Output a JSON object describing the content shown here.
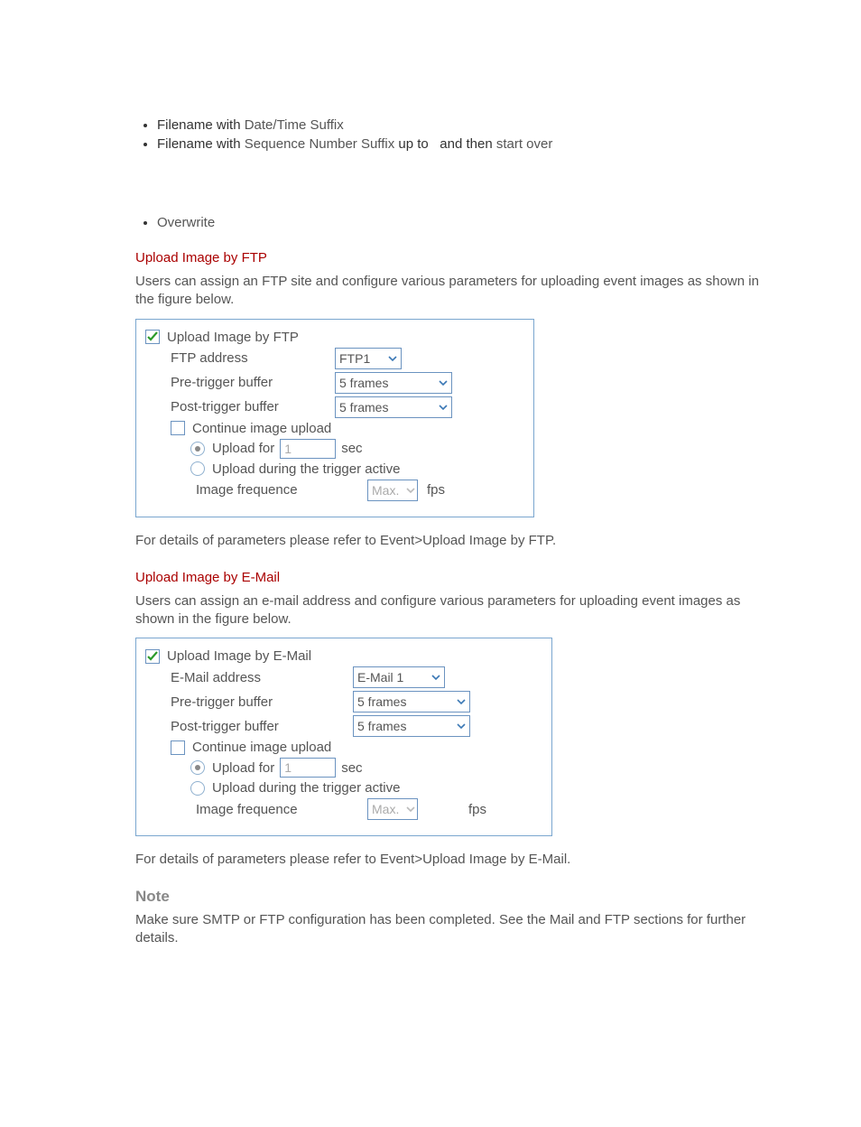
{
  "bullets": {
    "b1_pre": "Filename with",
    "b1_hl": "Date/Time Suffix",
    "b2_pre": "Filename with",
    "b2_hl": "Sequence Number Suffix",
    "b2_up_to": "up to",
    "b2_then": "and then",
    "b2_start_over": "start over",
    "b3_hl": "Overwrite"
  },
  "section1": {
    "heading": "Upload Image by FTP",
    "desc": "Users can assign an FTP site and configure various parameters for uploading event images as shown in the figure below.",
    "panel": {
      "title": "Upload Image by FTP",
      "addr_label": "FTP address",
      "addr_value": "FTP1",
      "pre_label": "Pre-trigger buffer",
      "pre_value": "5  frames",
      "post_label": "Post-trigger buffer",
      "post_value": "5  frames",
      "cont_label": "Continue image upload",
      "upload_for": "Upload for",
      "upload_for_val": "1",
      "sec": "sec",
      "upload_during": "Upload during the trigger active",
      "img_freq": "Image frequence",
      "img_freq_val": "Max.",
      "fps": "fps"
    },
    "closing": "For details of parameters please refer to Event>Upload Image by FTP."
  },
  "section2": {
    "heading": "Upload Image by E-Mail",
    "desc": "Users can assign an e-mail address and configure various parameters for uploading event images as shown in the figure below.",
    "panel": {
      "title": "Upload Image by E-Mail",
      "addr_label": "E-Mail address",
      "addr_value": "E-Mail 1",
      "pre_label": "Pre-trigger buffer",
      "pre_value": "5  frames",
      "post_label": "Post-trigger buffer",
      "post_value": "5  frames",
      "cont_label": "Continue image upload",
      "upload_for": "Upload for",
      "upload_for_val": "1",
      "sec": "sec",
      "upload_during": "Upload during the trigger active",
      "img_freq": "Image frequence",
      "img_freq_val": "Max.",
      "fps": "fps"
    },
    "closing": "For details of parameters please refer to Event>Upload Image by E-Mail."
  },
  "note": {
    "heading": "Note",
    "body": "Make sure SMTP or FTP configuration has been completed. See the Mail and FTP sections for further details."
  }
}
